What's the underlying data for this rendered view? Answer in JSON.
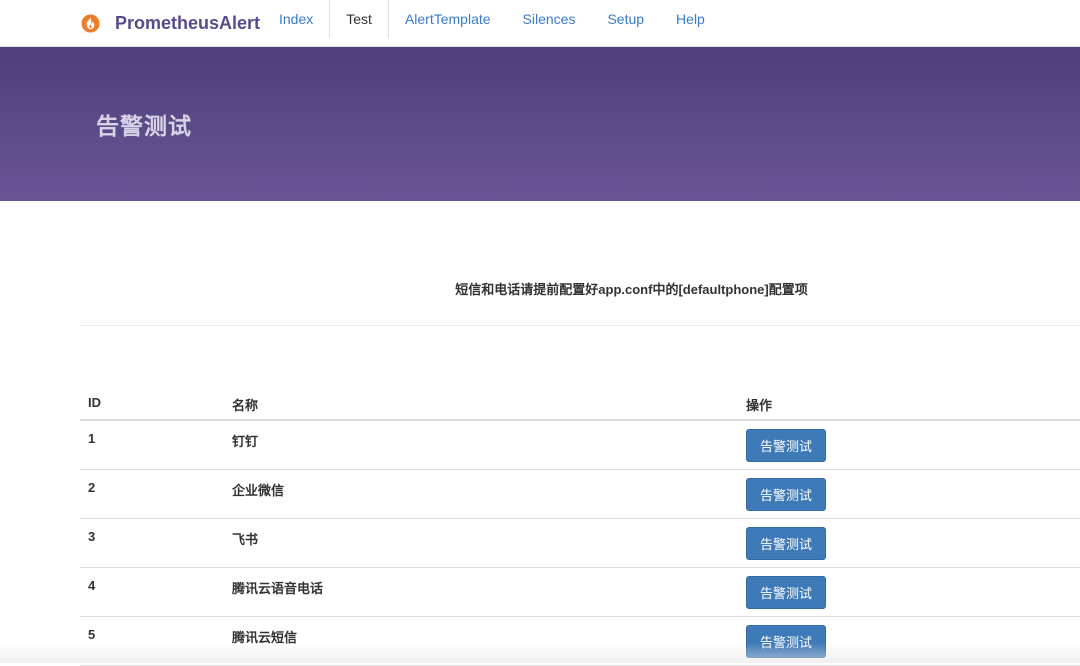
{
  "app": {
    "brand_name": "PrometheusAlert",
    "brand_icon": "flame-icon",
    "accent_color": "#f07b2a",
    "brand_color": "#5a4a8a"
  },
  "nav": {
    "items": [
      {
        "label": "Index",
        "active": false
      },
      {
        "label": "Test",
        "active": true
      },
      {
        "label": "AlertTemplate",
        "active": false
      },
      {
        "label": "Silences",
        "active": false
      },
      {
        "label": "Setup",
        "active": false
      },
      {
        "label": "Help",
        "active": false
      }
    ]
  },
  "hero": {
    "title": "告警测试"
  },
  "notice": {
    "text": "短信和电话请提前配置好app.conf中的[defaultphone]配置项"
  },
  "table": {
    "headers": {
      "id": "ID",
      "name": "名称",
      "op": "操作"
    },
    "rows": [
      {
        "id": "1",
        "name": "钉钉",
        "button": "告警测试"
      },
      {
        "id": "2",
        "name": "企业微信",
        "button": "告警测试"
      },
      {
        "id": "3",
        "name": "飞书",
        "button": "告警测试"
      },
      {
        "id": "4",
        "name": "腾讯云语音电话",
        "button": "告警测试"
      },
      {
        "id": "5",
        "name": "腾讯云短信",
        "button": "告警测试"
      }
    ]
  },
  "colors": {
    "hero_top": "#4f3e7a",
    "hero_bottom": "#6a5596",
    "link": "#3a7bc8",
    "button": "#3f7ab8"
  }
}
